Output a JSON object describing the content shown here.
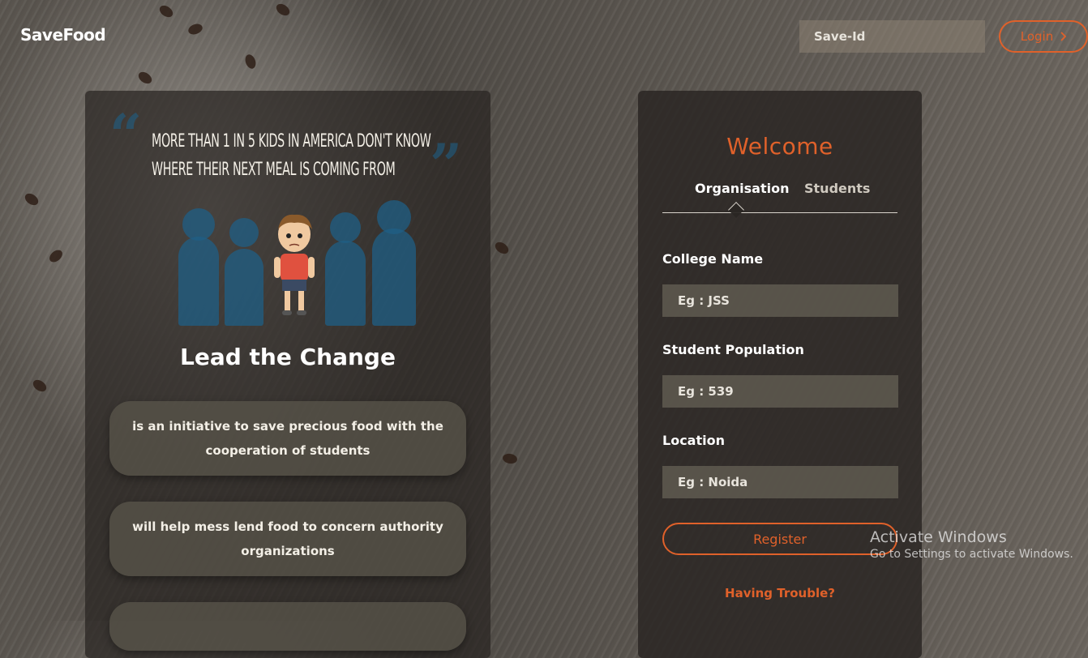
{
  "brand": "SaveFood",
  "header": {
    "saveid_placeholder": "Save-Id",
    "login_label": "Login",
    "login_icon": "chevron-right-icon"
  },
  "poster": {
    "line1": "More than 1 in 5 kids in America don't know",
    "line2": "where their next meal is coming from"
  },
  "left": {
    "title": "Lead the Change",
    "cards": [
      "is an initiative to save precious food with the cooperation of students",
      "will help mess lend food to concern authority organizations"
    ]
  },
  "form": {
    "welcome": "Welcome",
    "tabs": [
      {
        "label": "Organisation",
        "active": true
      },
      {
        "label": "Students",
        "active": false
      }
    ],
    "fields": [
      {
        "label": "College Name",
        "placeholder": "Eg : JSS"
      },
      {
        "label": "Student Population",
        "placeholder": "Eg : 539"
      },
      {
        "label": "Location",
        "placeholder": "Eg : Noida"
      }
    ],
    "register_label": "Register",
    "trouble_label": "Having Trouble?"
  },
  "watermark": {
    "title": "Activate Windows",
    "subtitle": "Go to Settings to activate Windows."
  },
  "colors": {
    "accent": "#e0612a",
    "poster_blue": "#1f5f85"
  }
}
